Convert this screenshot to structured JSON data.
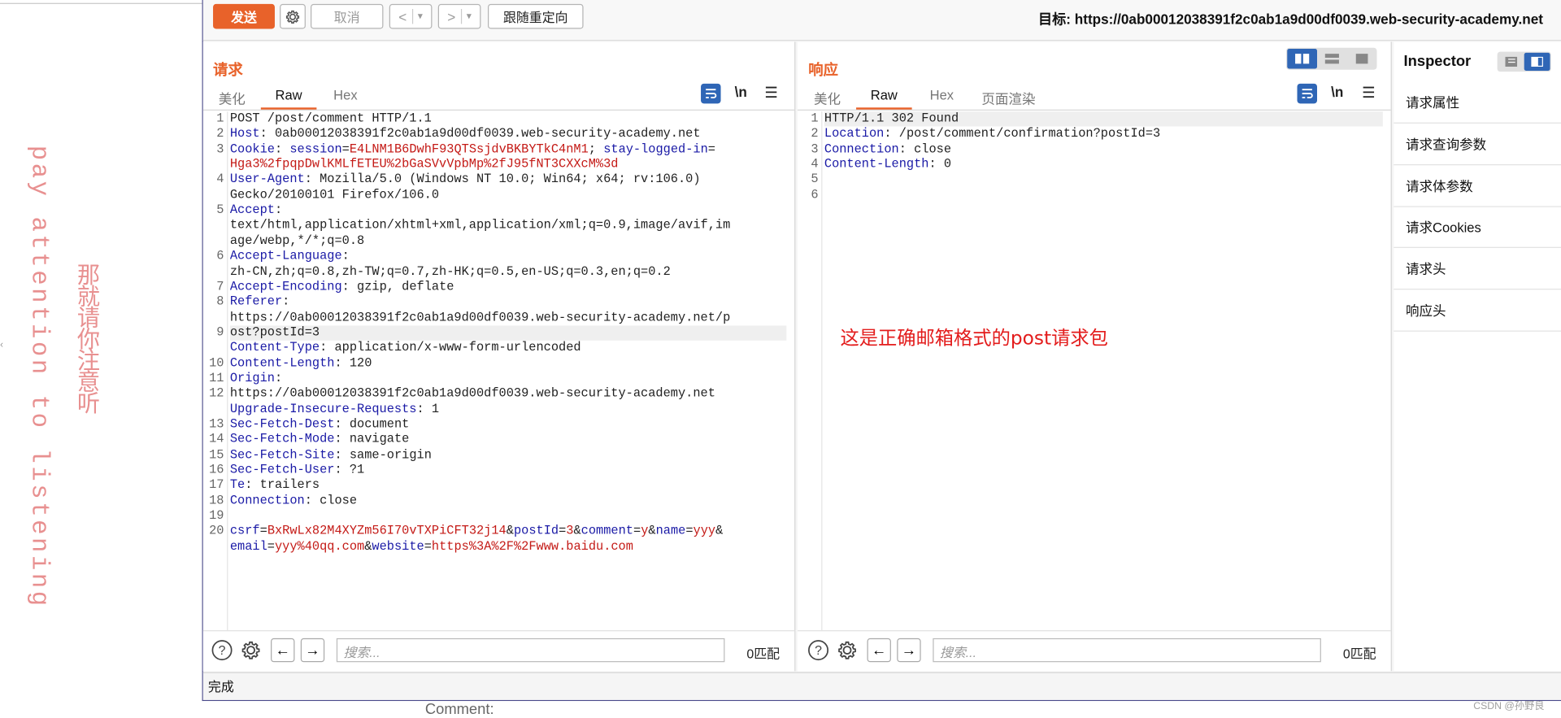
{
  "toolbar": {
    "send": "发送",
    "cancel": "取消",
    "back": "<",
    "forward": ">",
    "dropdown": "▾",
    "follow_redirect": "跟随重定向",
    "target": "目标: https://0ab00012038391f2c0ab1a9d00df0039.web-security-academy.net"
  },
  "request": {
    "title": "请求",
    "tabs": [
      "美化",
      "Raw",
      "Hex"
    ],
    "active_tab": "Raw",
    "newline_toggle": "\\n",
    "line_numbers": [
      "1",
      "2",
      "3",
      "4",
      "5",
      "6",
      "7",
      "8",
      "9",
      "10",
      "11",
      "12",
      "13",
      "14",
      "15",
      "16",
      "17",
      "18",
      "19",
      "20"
    ],
    "lines": [
      {
        "ln": "1",
        "text": "POST /post/comment HTTP/1.1"
      },
      {
        "ln": "2",
        "key": "Host",
        "val": "0ab00012038391f2c0ab1a9d00df0039.web-security-academy.net"
      },
      {
        "ln": "3",
        "key": "Cookie",
        "val": "session=E4LNM1B6DwhF93QTSsjdvBKBYTkC4nM1; stay-logged-in=Hga3%2fpqpDwlKMLfETEU%2bGaSVvVpbMp%2fJ95fNT3CXXcM%3d"
      },
      {
        "ln": "4",
        "key": "User-Agent",
        "val": "Mozilla/5.0 (Windows NT 10.0; Win64; x64; rv:106.0) Gecko/20100101 Firefox/106.0"
      },
      {
        "ln": "5",
        "key": "Accept",
        "val": "text/html,application/xhtml+xml,application/xml;q=0.9,image/avif,image/webp,*/*;q=0.8"
      },
      {
        "ln": "6",
        "key": "Accept-Language",
        "val": "zh-CN,zh;q=0.8,zh-TW;q=0.7,zh-HK;q=0.5,en-US;q=0.3,en;q=0.2"
      },
      {
        "ln": "7",
        "key": "Accept-Encoding",
        "val": "gzip, deflate"
      },
      {
        "ln": "8",
        "key": "Referer",
        "val": "https://0ab00012038391f2c0ab1a9d00df0039.web-security-academy.net/post?postId=3"
      },
      {
        "ln": "9",
        "key": "Content-Type",
        "val": "application/x-www-form-urlencoded"
      },
      {
        "ln": "10",
        "key": "Content-Length",
        "val": "120"
      },
      {
        "ln": "11",
        "key": "Origin",
        "val": "https://0ab00012038391f2c0ab1a9d00df0039.web-security-academy.net"
      },
      {
        "ln": "12",
        "key": "Upgrade-Insecure-Requests",
        "val": "1"
      },
      {
        "ln": "13",
        "key": "Sec-Fetch-Dest",
        "val": "document"
      },
      {
        "ln": "14",
        "key": "Sec-Fetch-Mode",
        "val": "navigate"
      },
      {
        "ln": "15",
        "key": "Sec-Fetch-Site",
        "val": "same-origin"
      },
      {
        "ln": "16",
        "key": "Sec-Fetch-User",
        "val": "?1"
      },
      {
        "ln": "17",
        "key": "Te",
        "val": "trailers"
      },
      {
        "ln": "18",
        "key": "Connection",
        "val": "close"
      },
      {
        "ln": "19",
        "text": ""
      },
      {
        "ln": "20",
        "body": "csrf=BxRwLx82M4XYZm56I70vTXPiCFT32j14&postId=3&comment=y&name=yyy&email=yyy%40qq.com&website=https%3A%2F%2Fwww.baidu.com"
      }
    ],
    "search_placeholder": "搜索...",
    "match_count": "0匹配"
  },
  "response": {
    "title": "响应",
    "tabs": [
      "美化",
      "Raw",
      "Hex",
      "页面渲染"
    ],
    "active_tab": "Raw",
    "newline_toggle": "\\n",
    "line_numbers": [
      "1",
      "2",
      "3",
      "4",
      "5",
      "6"
    ],
    "lines": [
      {
        "ln": "1",
        "text": "HTTP/1.1 302 Found"
      },
      {
        "ln": "2",
        "key": "Location",
        "val": "/post/comment/confirmation?postId=3"
      },
      {
        "ln": "3",
        "key": "Connection",
        "val": "close"
      },
      {
        "ln": "4",
        "key": "Content-Length",
        "val": "0"
      },
      {
        "ln": "5",
        "text": ""
      },
      {
        "ln": "6",
        "text": ""
      }
    ],
    "annotation": "这是正确邮箱格式的post请求包",
    "search_placeholder": "搜索...",
    "match_count": "0匹配"
  },
  "inspector": {
    "title": "Inspector",
    "items": [
      "请求属性",
      "请求查询参数",
      "请求体参数",
      "请求Cookies",
      "请求头",
      "响应头"
    ]
  },
  "status": "完成",
  "background": {
    "vertical_en": "pay attention to listening",
    "vertical_cn": "那就请你注意听",
    "comment_label": "Comment:",
    "watermark": "CSDN @孙野良"
  },
  "colors": {
    "accent": "#e8622a",
    "header_key": "#1a1aa6",
    "value_red": "#c41a16",
    "annotation": "#e31c1c",
    "tool_blue": "#2f66b6"
  }
}
